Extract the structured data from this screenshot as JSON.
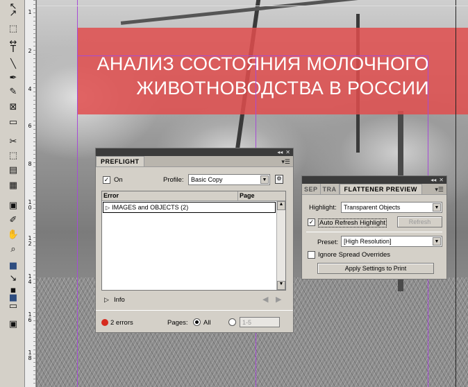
{
  "toolbar": {
    "tools": [
      "arrow-tool",
      "direct-select-tool",
      "page-tool",
      "gap-tool",
      "type-tool",
      "line-tool",
      "pen-tool",
      "pencil-tool",
      "rectangle-frame-tool",
      "rectangle-tool",
      "scissors-tool",
      "free-transform-tool",
      "gradient-tool",
      "gradient-feather-tool",
      "note-tool",
      "eyedropper-tool",
      "hand-tool",
      "zoom-tool",
      "fill-stroke-swatch",
      "swap-colors",
      "formatting-container",
      "apply-color",
      "normal-view-mode",
      "screen-mode"
    ],
    "glyphs": [
      "↖",
      "↗",
      "⬚",
      "↔",
      "T",
      "╲",
      "✒",
      "✎",
      "⊠",
      "▭",
      "✂",
      "⬚",
      "▤",
      "▦",
      "▣",
      "✐",
      "✋",
      "⌕",
      "■",
      "↘",
      "▪",
      "■",
      "▭",
      "▣"
    ]
  },
  "ruler": {
    "numbers": [
      "1",
      "2",
      "4",
      "6",
      "8",
      "1\n0",
      "1\n2",
      "1\n4",
      "1\n6",
      "1\n8"
    ]
  },
  "document": {
    "title_line1": "АНАЛИЗ СОСТОЯНИЯ МОЛОЧНОГО",
    "title_line2": "ЖИВОТНОВОДСТВА В РОССИИ",
    "banner_color": "#e04e4e",
    "guide_color": "#a64bd6"
  },
  "preflight": {
    "tab": "PREFLIGHT",
    "on_label": "On",
    "on_checked": "✓",
    "profile_label": "Profile:",
    "profile_value": "Basic Copy",
    "col_error": "Error",
    "col_page": "Page",
    "rows": [
      {
        "label": "IMAGES and OBJECTS (2)",
        "page": ""
      }
    ],
    "info_label": "Info",
    "error_count": "2 errors",
    "pages_label": "Pages:",
    "all_label": "All",
    "range_placeholder": "1-5",
    "status_color": "#d62a1e"
  },
  "flattener": {
    "tab_sep": "SEP",
    "tab_tra": "TRA",
    "tab_active": "FLATTENER PREVIEW",
    "highlight_label": "Highlight:",
    "highlight_value": "Transparent Objects",
    "auto_refresh_label": "Auto Refresh Highlight",
    "auto_refresh_checked": "✓",
    "refresh_label": "Refresh",
    "preset_label": "Preset:",
    "preset_value": "[High Resolution]",
    "ignore_label": "Ignore Spread Overrides",
    "apply_label": "Apply Settings to Print"
  }
}
